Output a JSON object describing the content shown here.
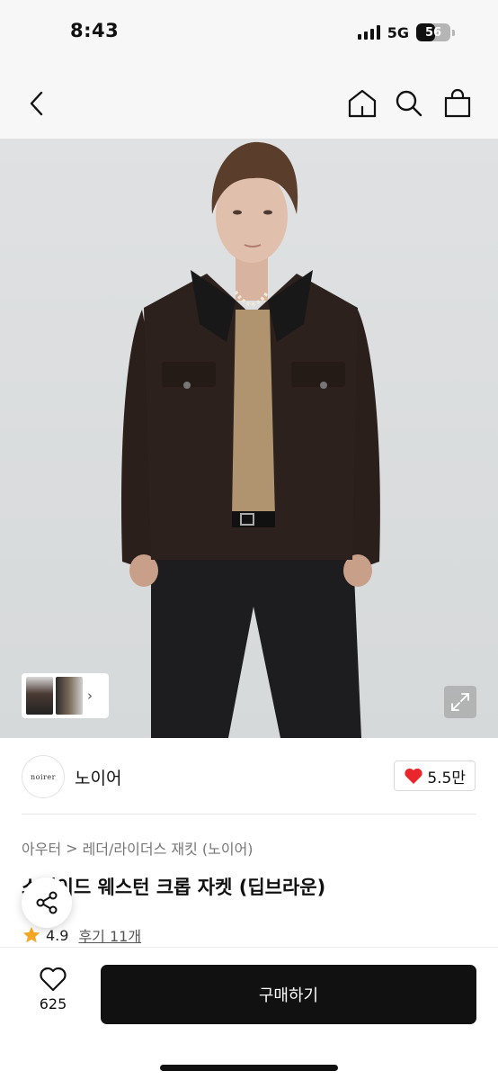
{
  "status_bar": {
    "time": "8:43",
    "network": "5G",
    "battery": "56",
    "battery_level_percent": 56
  },
  "nav": {
    "back_icon": "chevron-left-icon",
    "home_icon": "home-icon",
    "search_icon": "search-icon",
    "cart_icon": "shopping-bag-icon"
  },
  "hero": {
    "image_icon": "product-photo",
    "gallery_chevron": "›",
    "expand_icon": "expand-icon"
  },
  "brand": {
    "logo_text": "noirer",
    "name": "노이어",
    "like_icon": "heart-icon",
    "like_color": "#e8262b",
    "like_count": "5.5만"
  },
  "product": {
    "breadcrumb": {
      "category": "아우터",
      "separator": ">",
      "subcategory": "레더/라이더스 재킷 (노이어)"
    },
    "title": "스웨이드 웨스턴 크롭 자켓 (딥브라운)",
    "rating_icon": "star-icon",
    "rating_color": "#f5a623",
    "rating": "4.9",
    "reviews": "후기 11개"
  },
  "share": {
    "icon": "share-icon"
  },
  "bottom_bar": {
    "wish_icon": "heart-outline-icon",
    "wish_count": "625",
    "buy_label": "구매하기"
  }
}
